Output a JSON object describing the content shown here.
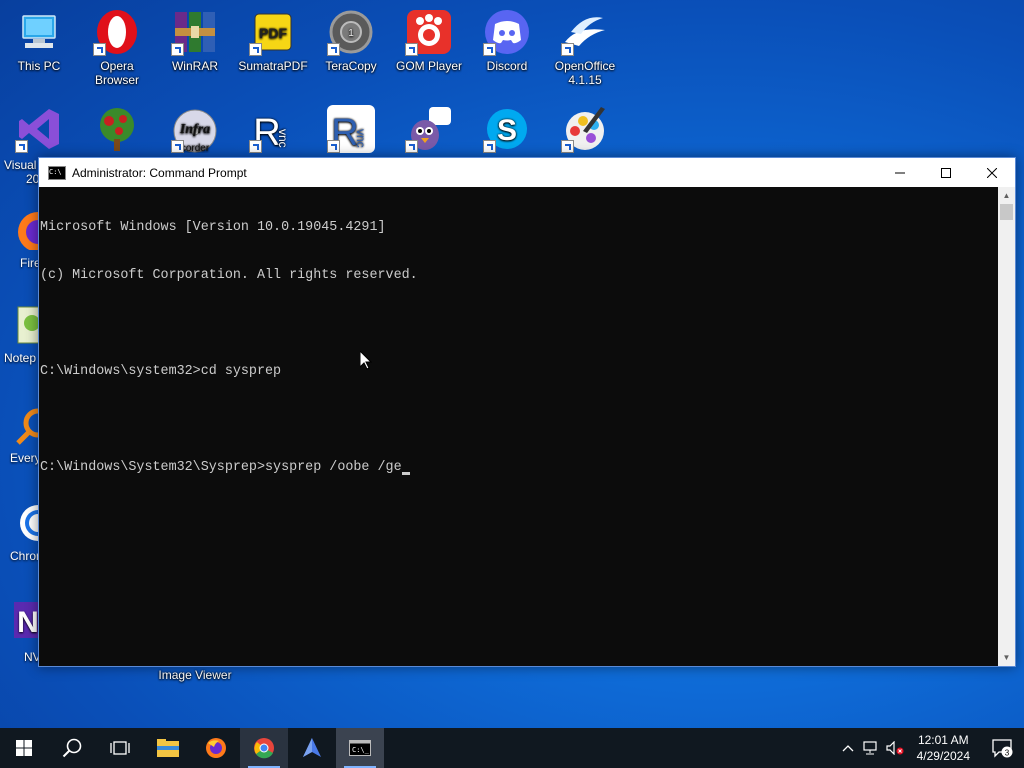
{
  "desktop": {
    "top_row": [
      {
        "label": "This PC",
        "icon": "computer-icon"
      },
      {
        "label": "Opera Browser",
        "icon": "opera-icon"
      },
      {
        "label": "WinRAR",
        "icon": "winrar-icon"
      },
      {
        "label": "SumatraPDF",
        "icon": "sumatrapdf-icon"
      },
      {
        "label": "TeraCopy",
        "icon": "teracopy-icon"
      },
      {
        "label": "GOM Player",
        "icon": "gom-player-icon"
      },
      {
        "label": "Discord",
        "icon": "discord-icon"
      },
      {
        "label": "OpenOffice 4.1.15",
        "icon": "openoffice-icon"
      }
    ],
    "left_column": [
      {
        "label": "Visual",
        "sublabel": "20",
        "icon": "visual-studio-icon"
      },
      {
        "label": "Fire",
        "icon": "firefox-icon"
      },
      {
        "label": "Notep",
        "icon": "notepad-icon"
      },
      {
        "label": "Every",
        "icon": "everything-icon"
      },
      {
        "label": "Chron",
        "icon": "chrome-icon"
      },
      {
        "label": "NV",
        "icon": "nvda-icon"
      }
    ],
    "hidden_label": "Image Viewer",
    "infra_text": "Infra",
    "infra_sub": "corder"
  },
  "window": {
    "title": "Administrator: Command Prompt",
    "icon_text": "C:\\",
    "console_lines": [
      "Microsoft Windows [Version 10.0.19045.4291]",
      "(c) Microsoft Corporation. All rights reserved.",
      "",
      "C:\\Windows\\system32>cd sysprep",
      "",
      "C:\\Windows\\System32\\Sysprep>sysprep /oobe /ge"
    ]
  },
  "taskbar": {
    "apps": [
      "start-icon",
      "search-icon",
      "task-view-icon",
      "file-explorer-icon",
      "firefox-icon",
      "chrome-icon",
      "app-icon",
      "command-prompt-icon"
    ],
    "time": "12:01 AM",
    "date": "4/29/2024",
    "notifications": "3"
  },
  "colors": {
    "console_bg": "#0c0c0c",
    "console_fg": "#cccccc",
    "taskbar": "#101820"
  }
}
